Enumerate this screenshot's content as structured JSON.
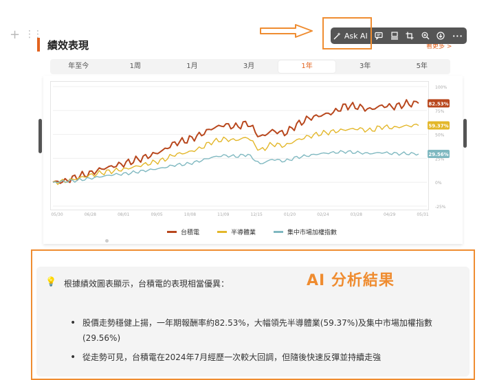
{
  "section": {
    "title": "績效表現",
    "see_more": "看更多 >"
  },
  "toolbar": {
    "ask_ai_label": "Ask AI",
    "icons": [
      "ask-ai-icon",
      "comment-icon",
      "layout-icon",
      "crop-icon",
      "zoom-in-icon",
      "download-icon",
      "more-icon"
    ]
  },
  "tabs": {
    "items": [
      "年至今",
      "1周",
      "1月",
      "3月",
      "1年",
      "3年",
      "5年"
    ],
    "active": "1年"
  },
  "chart_data": {
    "type": "line",
    "x_tick_labels": [
      "05/30",
      "06/28",
      "08/01",
      "09/05",
      "10/08",
      "11/09",
      "12/15",
      "01/20",
      "02/24",
      "03/28",
      "04/29",
      "05/31"
    ],
    "y_tick_labels": [
      "100%",
      "75%",
      "50%",
      "25%",
      "0%",
      "-25%"
    ],
    "ylim": [
      -25,
      100
    ],
    "series": [
      {
        "name": "台積電",
        "color": "#b8471d",
        "end_label": "82.53%",
        "values": [
          0,
          1,
          6,
          9,
          14,
          17,
          20,
          24,
          28,
          33,
          41,
          44,
          49,
          56,
          60,
          58,
          62,
          47,
          54,
          51,
          60,
          67,
          70,
          73,
          80,
          79,
          76,
          80,
          79,
          82,
          82.53
        ]
      },
      {
        "name": "半導體業",
        "color": "#e3b72a",
        "end_label": "59.37%",
        "values": [
          0,
          1,
          4,
          7,
          10,
          12,
          14,
          17,
          20,
          23,
          29,
          31,
          35,
          42,
          45,
          44,
          47,
          33,
          40,
          38,
          44,
          48,
          51,
          53,
          55,
          56,
          54,
          58,
          57,
          59,
          59.37
        ]
      },
      {
        "name": "集中市場加權指數",
        "color": "#7fb8c0",
        "end_label": "29.56%",
        "values": [
          0,
          1,
          2,
          4,
          6,
          8,
          9,
          11,
          13,
          15,
          18,
          19,
          22,
          26,
          28,
          27,
          29,
          19,
          24,
          22,
          26,
          28,
          30,
          31,
          32,
          31,
          30,
          31,
          30,
          30,
          29.56
        ]
      }
    ],
    "legend": [
      "台積電",
      "半導體業",
      "集中市場加權指數"
    ],
    "legend_position": "bottom"
  },
  "ai_panel": {
    "heading": "AI 分析結果",
    "intro": "根據績效圖表顯示，台積電的表現相當優異：",
    "bullets": [
      "股價走勢穩健上揚，一年期報酬率約82.53%，大幅領先半導體業(59.37%)及集中市場加權指數(29.56%)",
      "從走勢可見，台積電在2024年7月經歷一次較大回調，但隨後快速反彈並持續走強"
    ]
  },
  "colors": {
    "accent": "#e2631f",
    "highlight_box": "#ef8c30",
    "toolbar_bg": "#555555"
  }
}
